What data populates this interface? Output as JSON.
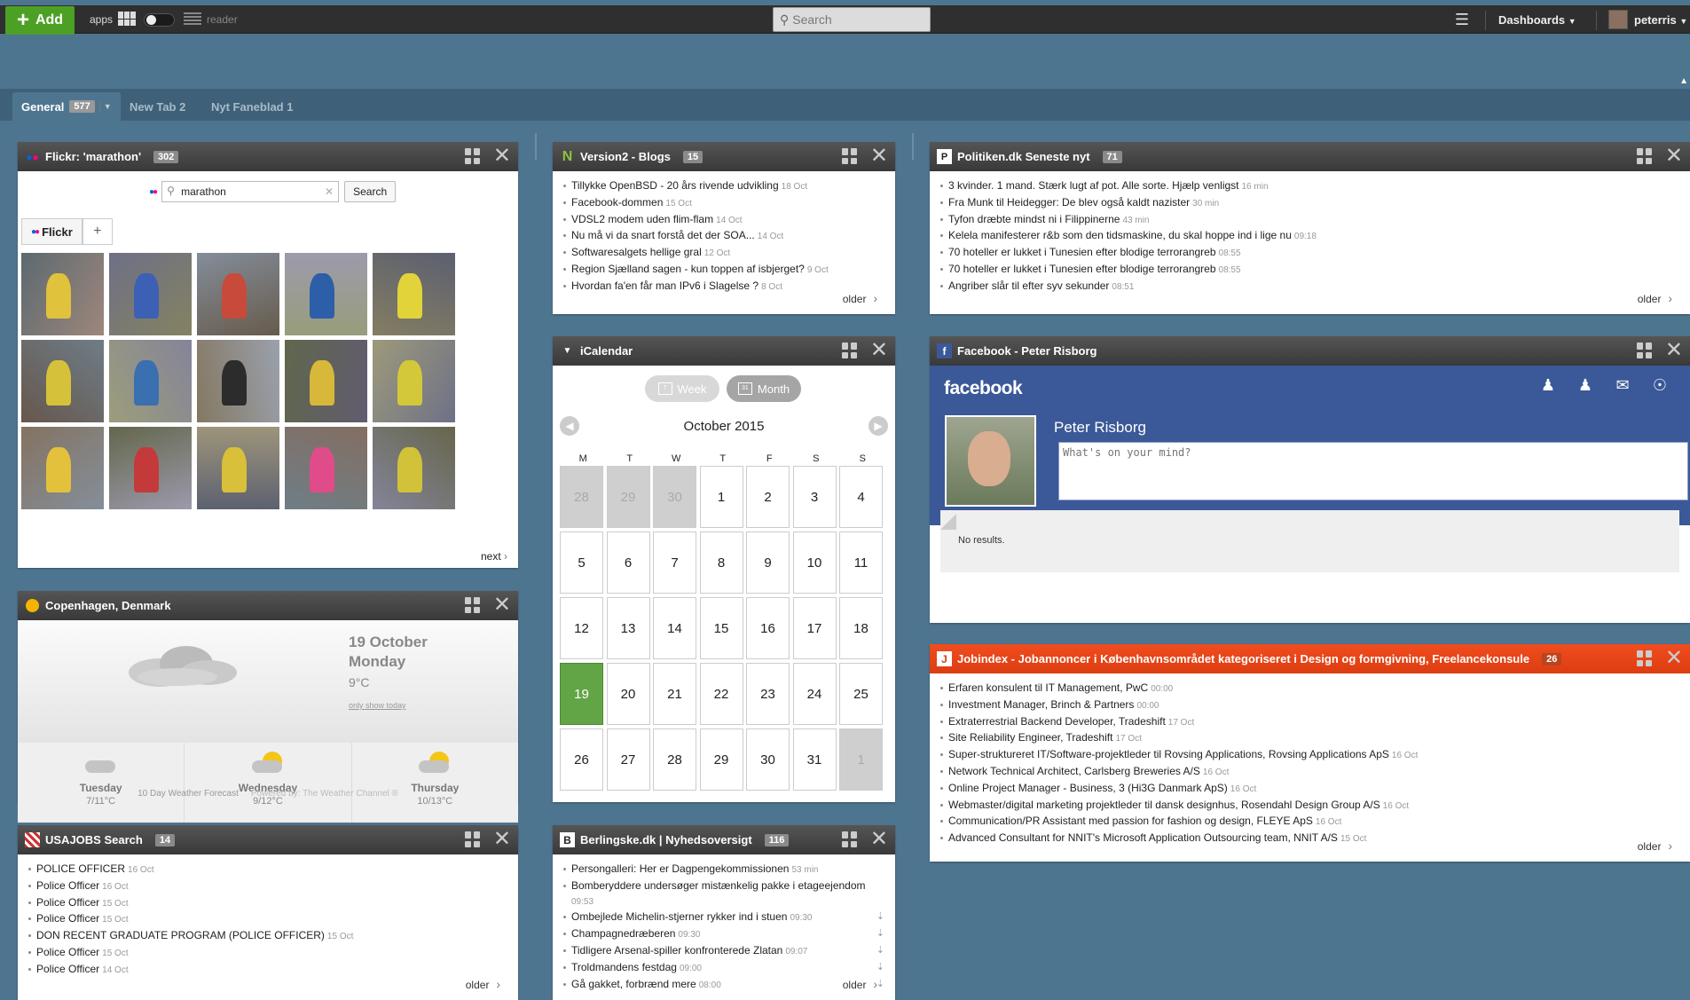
{
  "topbar": {
    "add_label": "Add",
    "apps_label": "apps",
    "reader_label": "reader",
    "search_placeholder": "Search",
    "dashboards_label": "Dashboards",
    "user_name": "peterris"
  },
  "tabs": [
    {
      "label": "General",
      "badge": "577",
      "active": true
    },
    {
      "label": "New Tab 2"
    },
    {
      "label": "Nyt Faneblad 1"
    }
  ],
  "flickr": {
    "title": "Flickr: 'marathon'",
    "badge": "302",
    "search_value": "marathon",
    "search_button": "Search",
    "tab_label": "Flickr",
    "tab_plus": "+",
    "next_label": "next",
    "photo_accents": [
      "#e0c23c",
      "#3c60b4",
      "#c84a3a",
      "#2d5ea8",
      "#e2d33a",
      "#d6c23a",
      "#3a6fb0",
      "#2c2c2c",
      "#d8b83a",
      "#d3c83a",
      "#e3c13c",
      "#c43a3a",
      "#d8c03a",
      "#e04c8a",
      "#d2c23a"
    ]
  },
  "weather": {
    "title": "Copenhagen, Denmark",
    "date_line1": "19 October",
    "date_line2": "Monday",
    "temp": "9°C",
    "only_show_today": "only show today",
    "days": [
      {
        "name": "Tuesday",
        "temp": "7/11°C",
        "sun": false
      },
      {
        "name": "Wednesday",
        "temp": "9/12°C",
        "sun": true
      },
      {
        "name": "Thursday",
        "temp": "10/13°C",
        "sun": true
      }
    ],
    "forecast_link": "10 Day Weather Forecast",
    "powered_by": "Powered by: The Weather Channel ®"
  },
  "usajobs": {
    "title": "USAJOBS Search",
    "badge": "14",
    "older": "older",
    "items": [
      {
        "text": "POLICE OFFICER",
        "time": "16 Oct"
      },
      {
        "text": "Police Officer",
        "time": "16 Oct"
      },
      {
        "text": "Police Officer",
        "time": "15 Oct"
      },
      {
        "text": "Police Officer",
        "time": "15 Oct"
      },
      {
        "text": "DON RECENT GRADUATE PROGRAM (POLICE OFFICER)",
        "time": "15 Oct"
      },
      {
        "text": "Police Officer",
        "time": "15 Oct"
      },
      {
        "text": "Police Officer",
        "time": "14 Oct"
      }
    ]
  },
  "version2": {
    "title": "Version2 - Blogs",
    "badge": "15",
    "older": "older",
    "items": [
      {
        "text": "Tillykke OpenBSD - 20 års rivende udvikling",
        "time": "18 Oct"
      },
      {
        "text": "Facebook-dommen",
        "time": "15 Oct"
      },
      {
        "text": "VDSL2 modem uden flim-flam",
        "time": "14 Oct"
      },
      {
        "text": "Nu må vi da snart forstå det der SOA...",
        "time": "14 Oct"
      },
      {
        "text": "Softwaresalgets hellige gral",
        "time": "12 Oct"
      },
      {
        "text": "Region Sjælland sagen - kun toppen af isbjerget?",
        "time": "9 Oct"
      },
      {
        "text": "Hvordan fa'en får man IPv6 i Slagelse ?",
        "time": "8 Oct"
      }
    ]
  },
  "calendar": {
    "title": "iCalendar",
    "week_label": "Week",
    "month_label": "Month",
    "week_icon": "7",
    "month_icon": "31",
    "month_title": "October 2015",
    "dow": [
      "M",
      "T",
      "W",
      "T",
      "F",
      "S",
      "S"
    ],
    "days": [
      {
        "d": "28",
        "m": 1
      },
      {
        "d": "29",
        "m": 1
      },
      {
        "d": "30",
        "m": 1
      },
      {
        "d": "1"
      },
      {
        "d": "2"
      },
      {
        "d": "3"
      },
      {
        "d": "4"
      },
      {
        "d": "5"
      },
      {
        "d": "6"
      },
      {
        "d": "7"
      },
      {
        "d": "8"
      },
      {
        "d": "9"
      },
      {
        "d": "10"
      },
      {
        "d": "11"
      },
      {
        "d": "12"
      },
      {
        "d": "13"
      },
      {
        "d": "14"
      },
      {
        "d": "15"
      },
      {
        "d": "16"
      },
      {
        "d": "17"
      },
      {
        "d": "18"
      },
      {
        "d": "19",
        "t": 1
      },
      {
        "d": "20"
      },
      {
        "d": "21"
      },
      {
        "d": "22"
      },
      {
        "d": "23"
      },
      {
        "d": "24"
      },
      {
        "d": "25"
      },
      {
        "d": "26"
      },
      {
        "d": "27"
      },
      {
        "d": "28"
      },
      {
        "d": "29"
      },
      {
        "d": "30"
      },
      {
        "d": "31"
      },
      {
        "d": "1",
        "m": 1
      }
    ]
  },
  "berlingske": {
    "title": "Berlingske.dk | Nyhedsoversigt",
    "badge": "116",
    "older": "older",
    "items": [
      {
        "text": "Persongalleri: Her er Dagpengekommissionen",
        "time": "53 min"
      },
      {
        "text": "Bomberyddere undersøger mistænkelig pakke i etageejendom",
        "time": "09:53"
      },
      {
        "text": "Ombejlede Michelin-stjerner rykker ind i stuen",
        "time": "09:30"
      },
      {
        "text": "Champagnedræberen",
        "time": "09:30"
      },
      {
        "text": "Tidligere Arsenal-spiller konfronterede Zlatan",
        "time": "09:07"
      },
      {
        "text": "Troldmandens festdag",
        "time": "09:00"
      },
      {
        "text": "Gå gakket, forbrænd mere",
        "time": "08:00"
      }
    ]
  },
  "politiken": {
    "title": "Politiken.dk Seneste nyt",
    "badge": "71",
    "older": "older",
    "items": [
      {
        "text": "3 kvinder. 1 mand. Stærk lugt af pot. Alle sorte. Hjælp venligst",
        "time": "16 min"
      },
      {
        "text": "Fra Munk til Heidegger: De blev også kaldt nazister",
        "time": "30 min"
      },
      {
        "text": "Tyfon dræbte mindst ni i Filippinerne",
        "time": "43 min"
      },
      {
        "text": "Kelela manifesterer r&b som den tidsmaskine, du skal hoppe ind i lige nu",
        "time": "09:18"
      },
      {
        "text": "70 hoteller er lukket i Tunesien efter blodige terrorangreb",
        "time": "08:55"
      },
      {
        "text": "70 hoteller er lukket i Tunesien efter blodige terrorangreb",
        "time": "08:55"
      },
      {
        "text": "Angriber slår til efter syv sekunder",
        "time": "08:51"
      }
    ]
  },
  "facebook": {
    "title": "Facebook - Peter Risborg",
    "logo": "facebook",
    "name": "Peter Risborg",
    "status_placeholder": "What's on your mind?",
    "no_results": "No results."
  },
  "jobindex": {
    "title": "Jobindex - Jobannoncer i Københavnsområdet kategoriseret i Design og formgivning, Freelancekonsule",
    "badge": "26",
    "older": "older",
    "items": [
      {
        "text": "Erfaren konsulent til IT Management, PwC",
        "time": "00:00"
      },
      {
        "text": "Investment Manager, Brinch & Partners",
        "time": "00:00"
      },
      {
        "text": "Extraterrestrial Backend Developer, Tradeshift",
        "time": "17 Oct"
      },
      {
        "text": "Site Reliability Engineer, Tradeshift",
        "time": "17 Oct"
      },
      {
        "text": "Super-strukturerеt IT/Software-projektleder til Rovsing Applications, Rovsing Applications ApS",
        "time": "16 Oct"
      },
      {
        "text": "Network Technical Architect, Carlsberg Breweries A/S",
        "time": "16 Oct"
      },
      {
        "text": "Online Project Manager - Business, 3 (Hi3G Danmark ApS)",
        "time": "16 Oct"
      },
      {
        "text": "Webmaster/digital marketing projektleder til dansk designhus, Rosendahl Design Group A/S",
        "time": "16 Oct"
      },
      {
        "text": "Communication/PR Assistant med passion for fashion og design, FLEYE ApS",
        "time": "16 Oct"
      },
      {
        "text": "Advanced Consultant for NNIT's Microsoft Application Outsourcing team, NNIT A/S",
        "time": "15 Oct"
      }
    ]
  }
}
